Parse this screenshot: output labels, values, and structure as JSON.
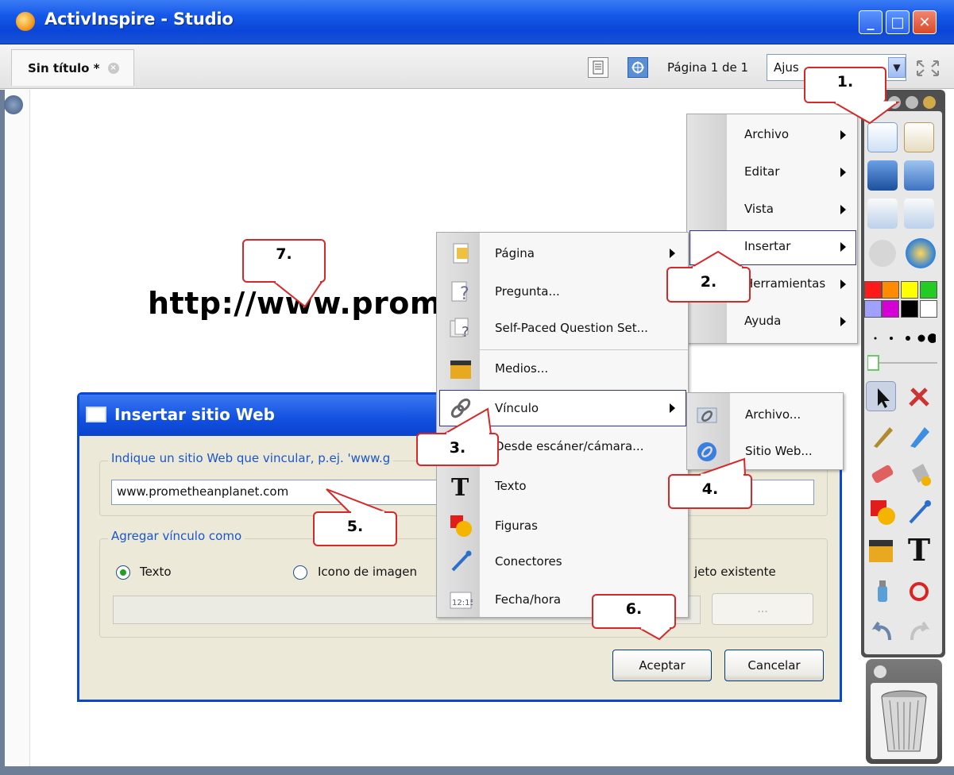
{
  "window": {
    "title": "ActivInspire - Studio",
    "minimize": "_",
    "maximize": "□",
    "close": "✕"
  },
  "tabbar": {
    "doc_tab": "Sin título *",
    "tab_close": "×",
    "page_label": "Página 1 de 1",
    "zoom_value": "Ajus",
    "zoom_arrow": "▼"
  },
  "canvas": {
    "big_url_text": "http://www.prom"
  },
  "main_menu": {
    "items": [
      {
        "label": "Archivo"
      },
      {
        "label": "Editar"
      },
      {
        "label": "Vista"
      },
      {
        "label": "Insertar"
      },
      {
        "label": "Herramientas"
      },
      {
        "label": "Ayuda"
      }
    ]
  },
  "insert_menu": {
    "items": [
      {
        "label": "Página",
        "icon": "page-icon"
      },
      {
        "label": "Pregunta...",
        "icon": "question-icon"
      },
      {
        "label": "Self-Paced Question Set...",
        "icon": "question-set-icon"
      },
      {
        "label": "Medios...",
        "icon": "media-icon"
      },
      {
        "label": "Vínculo",
        "icon": "link-icon"
      },
      {
        "label": "Desde escáner/cámara...",
        "icon": "scanner-icon"
      },
      {
        "label": "Texto",
        "icon": "text-icon"
      },
      {
        "label": "Figuras",
        "icon": "shapes-icon"
      },
      {
        "label": "Conectores",
        "icon": "connector-icon"
      },
      {
        "label": "Fecha/hora",
        "icon": "datetime-icon"
      }
    ]
  },
  "link_submenu": {
    "items": [
      {
        "label": "Archivo...",
        "icon": "file-link-icon"
      },
      {
        "label": "Sitio Web...",
        "icon": "web-link-icon"
      }
    ]
  },
  "dialog": {
    "title": "Insertar sitio Web",
    "url_group_label": "Indique un sitio Web que vincular, p.ej. 'www.g",
    "url_value": "www.prometheanplanet.com",
    "add_as_group_label": "Agregar vínculo como",
    "radio_text": "Texto",
    "radio_image": "Icono de imagen",
    "radio_existing": "jeto existente",
    "browse": "...",
    "ok": "Aceptar",
    "cancel": "Cancelar"
  },
  "callouts": [
    "1.",
    "2.",
    "3.",
    "4.",
    "5.",
    "6.",
    "7."
  ],
  "toolbox": {
    "colors": [
      "#ff1a1a",
      "#ff8c00",
      "#ffff00",
      "#22cc22",
      "#a0a0ff",
      "#d600d6",
      "#000000",
      "#ffffff"
    ]
  },
  "colors": {
    "xp_blue": "#0a46d8",
    "callout_red": "#d62828",
    "menu_highlight_border": "#33338f"
  }
}
